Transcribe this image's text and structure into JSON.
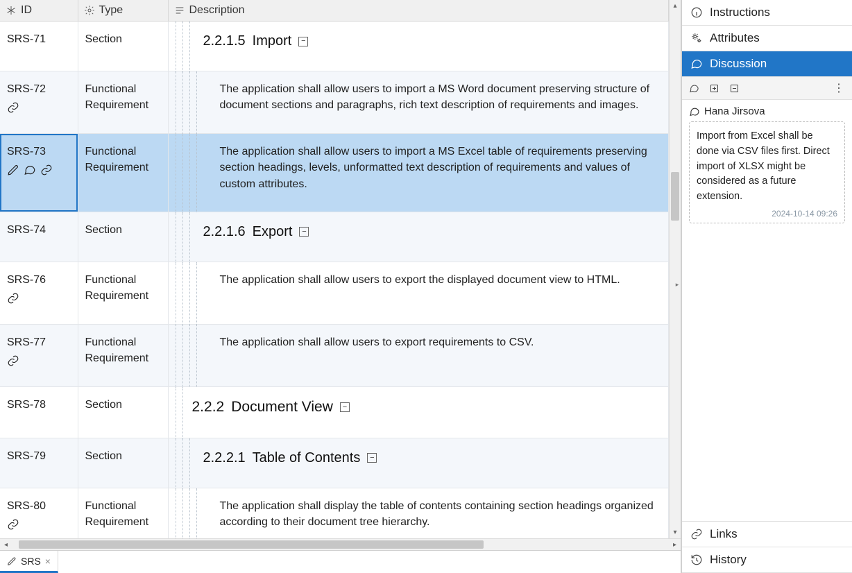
{
  "columns": {
    "id": "ID",
    "type": "Type",
    "description": "Description"
  },
  "tab": {
    "label": "SRS"
  },
  "rows": [
    {
      "id": "SRS-71",
      "type": "Section",
      "hnum": "2.2.1.5",
      "htitle": "Import",
      "desc": "",
      "icons": [],
      "level": 3,
      "alt": false
    },
    {
      "id": "SRS-72",
      "type": "Functional Requirement",
      "desc": "The application shall allow users to import a MS Word document preserving structure of document sections and paragraphs, rich text description of requirements and images.",
      "icons": [
        "link"
      ],
      "level": 4,
      "alt": true
    },
    {
      "id": "SRS-73",
      "type": "Functional Requirement",
      "desc": "The application shall allow users to import a MS Excel table of requirements preserving section headings, levels, unformatted text description of requirements and values of custom attributes.",
      "icons": [
        "pencil",
        "chat",
        "link"
      ],
      "level": 4,
      "selected": true
    },
    {
      "id": "SRS-74",
      "type": "Section",
      "hnum": "2.2.1.6",
      "htitle": "Export",
      "desc": "",
      "icons": [],
      "level": 3,
      "alt": true
    },
    {
      "id": "SRS-76",
      "type": "Functional Requirement",
      "desc": "The application shall allow users to export the displayed document view to HTML.",
      "icons": [
        "link"
      ],
      "level": 4,
      "alt": false
    },
    {
      "id": "SRS-77",
      "type": "Functional Requirement",
      "desc": "The application shall allow users to export requirements to CSV.",
      "icons": [
        "link"
      ],
      "level": 4,
      "alt": true
    },
    {
      "id": "SRS-78",
      "type": "Section",
      "hnum": "2.2.2",
      "htitle": "Document View",
      "desc": "",
      "icons": [],
      "level": 2,
      "alt": false
    },
    {
      "id": "SRS-79",
      "type": "Section",
      "hnum": "2.2.2.1",
      "htitle": "Table of Contents",
      "desc": "",
      "icons": [],
      "level": 3,
      "alt": true
    },
    {
      "id": "SRS-80",
      "type": "Functional Requirement",
      "desc": "The application shall display the table of contents containing section headings organized according to their document tree hierarchy.",
      "icons": [
        "link"
      ],
      "level": 4,
      "alt": false
    }
  ],
  "side": {
    "instructions": "Instructions",
    "attributes": "Attributes",
    "discussion": "Discussion",
    "links": "Links",
    "history": "History"
  },
  "discussion": {
    "author": "Hana Jirsova",
    "comment": "Import from Excel shall be done via CSV files first. Direct import of XLSX might be considered as a future extension.",
    "timestamp": "2024-10-14 09:26"
  }
}
